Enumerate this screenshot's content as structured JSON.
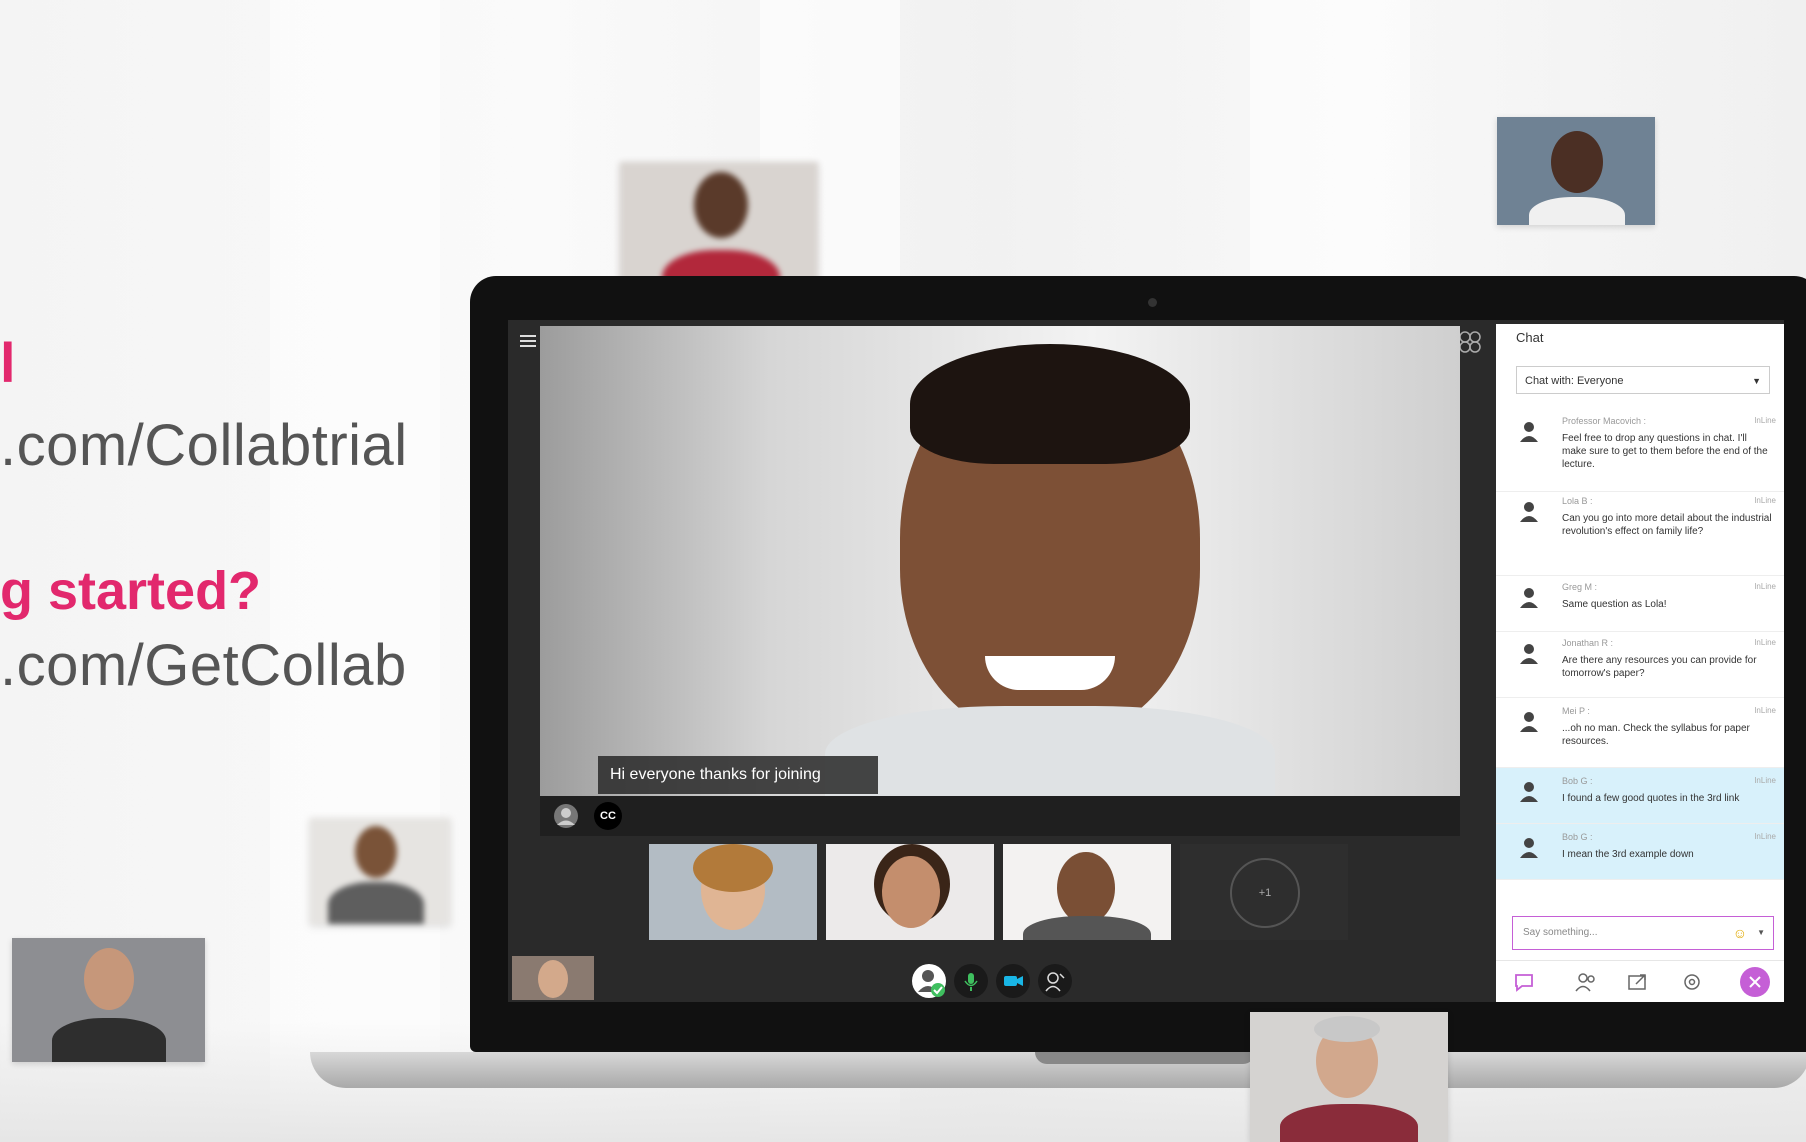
{
  "promo": {
    "line1": "l",
    "url1": ".com/Collabtrial",
    "headline2": "g started?",
    "url2": ".com/GetCollab"
  },
  "session": {
    "caption": "Hi everyone thanks for joining",
    "cc_label": "CC",
    "overflow_count": "+1"
  },
  "chat": {
    "title": "Chat",
    "channel": "Chat with: Everyone",
    "input_placeholder": "Say something...",
    "messages": [
      {
        "author": "Professor Macovich :",
        "time": "InLine",
        "text": "Feel free to drop any questions in chat. I'll make sure to get to them before the end of the lecture."
      },
      {
        "author": "Lola B :",
        "time": "InLine",
        "text": "Can you go into more detail about the industrial revolution's effect on family life?"
      },
      {
        "author": "Greg M :",
        "time": "InLine",
        "text": "Same question as Lola!"
      },
      {
        "author": "Jonathan R :",
        "time": "InLine",
        "text": "Are there any resources you can provide for tomorrow's paper?"
      },
      {
        "author": "Mei P :",
        "time": "InLine",
        "text": "...oh no man. Check the syllabus for paper resources."
      },
      {
        "author": "Bob G :",
        "time": "InLine",
        "text": "I found a few good quotes in the 3rd link"
      },
      {
        "author": "Bob G :",
        "time": "InLine",
        "text": "I mean the 3rd example down"
      }
    ]
  },
  "colors": {
    "accent": "#e2286d",
    "chat_highlight": "#d8f1fb",
    "input_border": "#c55fd6",
    "camera_on": "#19b6e6",
    "mic_on": "#3fbf5f"
  }
}
